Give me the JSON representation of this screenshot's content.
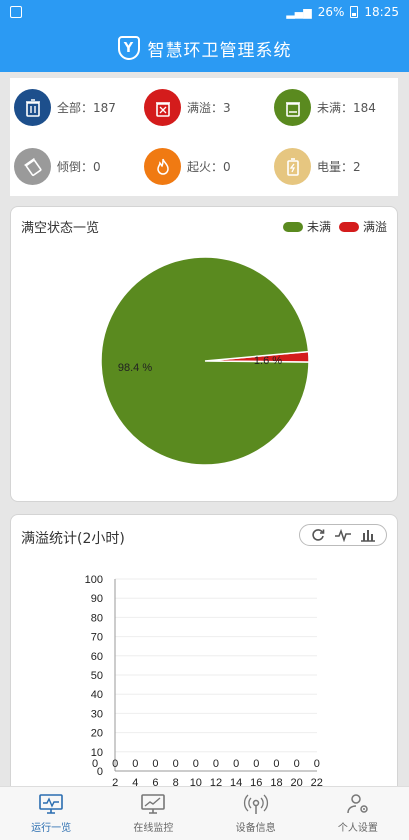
{
  "status_bar": {
    "battery_text": "26%",
    "time": "18:25"
  },
  "header": {
    "logo_letter": "Y",
    "title": "智慧环卫管理系统"
  },
  "summary": [
    {
      "label": "全部：187",
      "icon": "trash-bin-icon",
      "color": "#1d4f8c"
    },
    {
      "label": "满溢：3",
      "icon": "overflow-bin-icon",
      "color": "#d41c1c"
    },
    {
      "label": "未满：184",
      "icon": "not-full-bin-icon",
      "color": "#5a8a1f"
    },
    {
      "label": "倾倒：0",
      "icon": "tipped-bin-icon",
      "color": "#9a9a9a"
    },
    {
      "label": "起火：0",
      "icon": "fire-icon",
      "color": "#f07a12"
    },
    {
      "label": "电量：2",
      "icon": "battery-icon",
      "color": "#e6c680"
    }
  ],
  "pie_card": {
    "title": "满空状态一览",
    "legend": [
      {
        "name": "未满",
        "color": "#5a8a1f"
      },
      {
        "name": "满溢",
        "color": "#d41c1c"
      }
    ]
  },
  "bar_card": {
    "title": "满溢统计(2小时)",
    "toolbox": [
      "refresh-icon",
      "line-chart-icon",
      "bar-chart-icon"
    ]
  },
  "chart_data": [
    {
      "type": "pie",
      "labels": [
        "未满",
        "满溢"
      ],
      "values": [
        184,
        3
      ],
      "data_labels": [
        "98.4 %",
        "1.6 %"
      ],
      "colors": [
        "#5a8a1f",
        "#d41c1c"
      ],
      "legend_position": "top-right"
    },
    {
      "type": "bar",
      "categories": [
        "0",
        "2",
        "4",
        "6",
        "8",
        "10",
        "12",
        "14",
        "16",
        "18",
        "20",
        "22"
      ],
      "values": [
        0,
        0,
        0,
        0,
        0,
        0,
        0,
        0,
        0,
        0,
        0,
        0
      ],
      "ylim": [
        0,
        100
      ],
      "yticks": [
        0,
        10,
        20,
        30,
        40,
        50,
        60,
        70,
        80,
        90,
        100
      ],
      "grid": true
    }
  ],
  "tabs": [
    {
      "label": "运行一览",
      "icon": "dashboard-monitor-icon",
      "active": true
    },
    {
      "label": "在线监控",
      "icon": "trend-monitor-icon",
      "active": false
    },
    {
      "label": "设备信息",
      "icon": "broadcast-icon",
      "active": false
    },
    {
      "label": "个人设置",
      "icon": "user-settings-icon",
      "active": false
    }
  ]
}
